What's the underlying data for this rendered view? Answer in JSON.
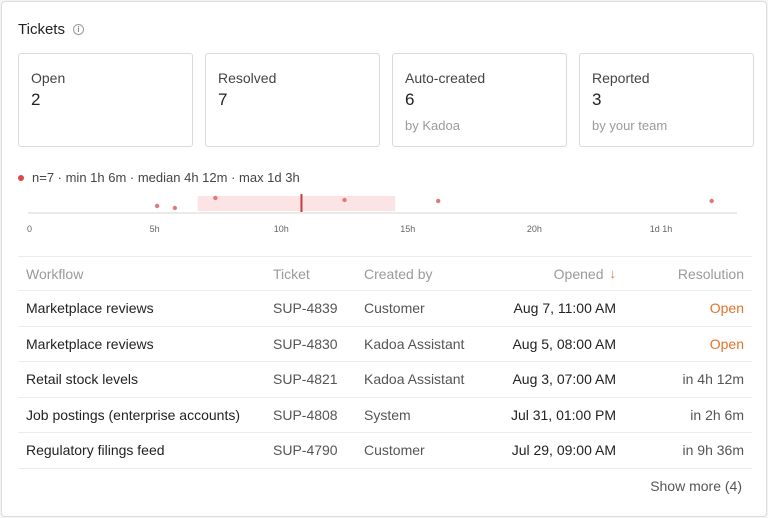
{
  "header": {
    "title": "Tickets",
    "info_icon": "info-icon"
  },
  "cards": [
    {
      "label": "Open",
      "value": "2",
      "sub": ""
    },
    {
      "label": "Resolved",
      "value": "7",
      "sub": ""
    },
    {
      "label": "Auto-created",
      "value": "6",
      "sub": "by Kadoa"
    },
    {
      "label": "Reported",
      "value": "3",
      "sub": "by your team"
    }
  ],
  "summary": {
    "text": "n=7 · min 1h 6m · median 4h 12m · max 1d 3h",
    "dot_color": "#e0474c"
  },
  "chart_data": {
    "type": "scatter",
    "x_unit": "hours",
    "xlim": [
      0,
      28
    ],
    "ticks": [
      {
        "label": "0",
        "value": 0
      },
      {
        "label": "5h",
        "value": 5
      },
      {
        "label": "10h",
        "value": 10
      },
      {
        "label": "15h",
        "value": 15
      },
      {
        "label": "20h",
        "value": 20
      },
      {
        "label": "1d 1h",
        "value": 25
      }
    ],
    "points": [
      5.1,
      5.8,
      7.4,
      12.5,
      16.2,
      27.0
    ],
    "median": 10.8,
    "iqr": [
      6.7,
      14.5
    ],
    "point_color": "#e07a7a",
    "median_color": "#c63d3d",
    "band_color": "#fde4e4"
  },
  "table": {
    "columns": {
      "workflow": "Workflow",
      "ticket": "Ticket",
      "created_by": "Created by",
      "opened": "Opened",
      "resolution": "Resolution"
    },
    "sort_icon": "arrow-down-icon",
    "rows": [
      {
        "workflow": "Marketplace reviews",
        "ticket": "SUP-4839",
        "created_by": "Customer",
        "opened": "Aug 7, 11:00 AM",
        "resolution": "Open",
        "open": true
      },
      {
        "workflow": "Marketplace reviews",
        "ticket": "SUP-4830",
        "created_by": "Kadoa Assistant",
        "opened": "Aug 5, 08:00 AM",
        "resolution": "Open",
        "open": true
      },
      {
        "workflow": "Retail stock levels",
        "ticket": "SUP-4821",
        "created_by": "Kadoa Assistant",
        "opened": "Aug 3, 07:00 AM",
        "resolution": "in 4h 12m",
        "open": false
      },
      {
        "workflow": "Job postings (enterprise accounts)",
        "ticket": "SUP-4808",
        "created_by": "System",
        "opened": "Jul 31, 01:00 PM",
        "resolution": "in 2h 6m",
        "open": false
      },
      {
        "workflow": "Regulatory filings feed",
        "ticket": "SUP-4790",
        "created_by": "Customer",
        "opened": "Jul 29, 09:00 AM",
        "resolution": "in 9h 36m",
        "open": false
      }
    ]
  },
  "show_more": "Show more (4)",
  "colors": {
    "accent": "#e0742c",
    "border": "#d9d9d9"
  }
}
